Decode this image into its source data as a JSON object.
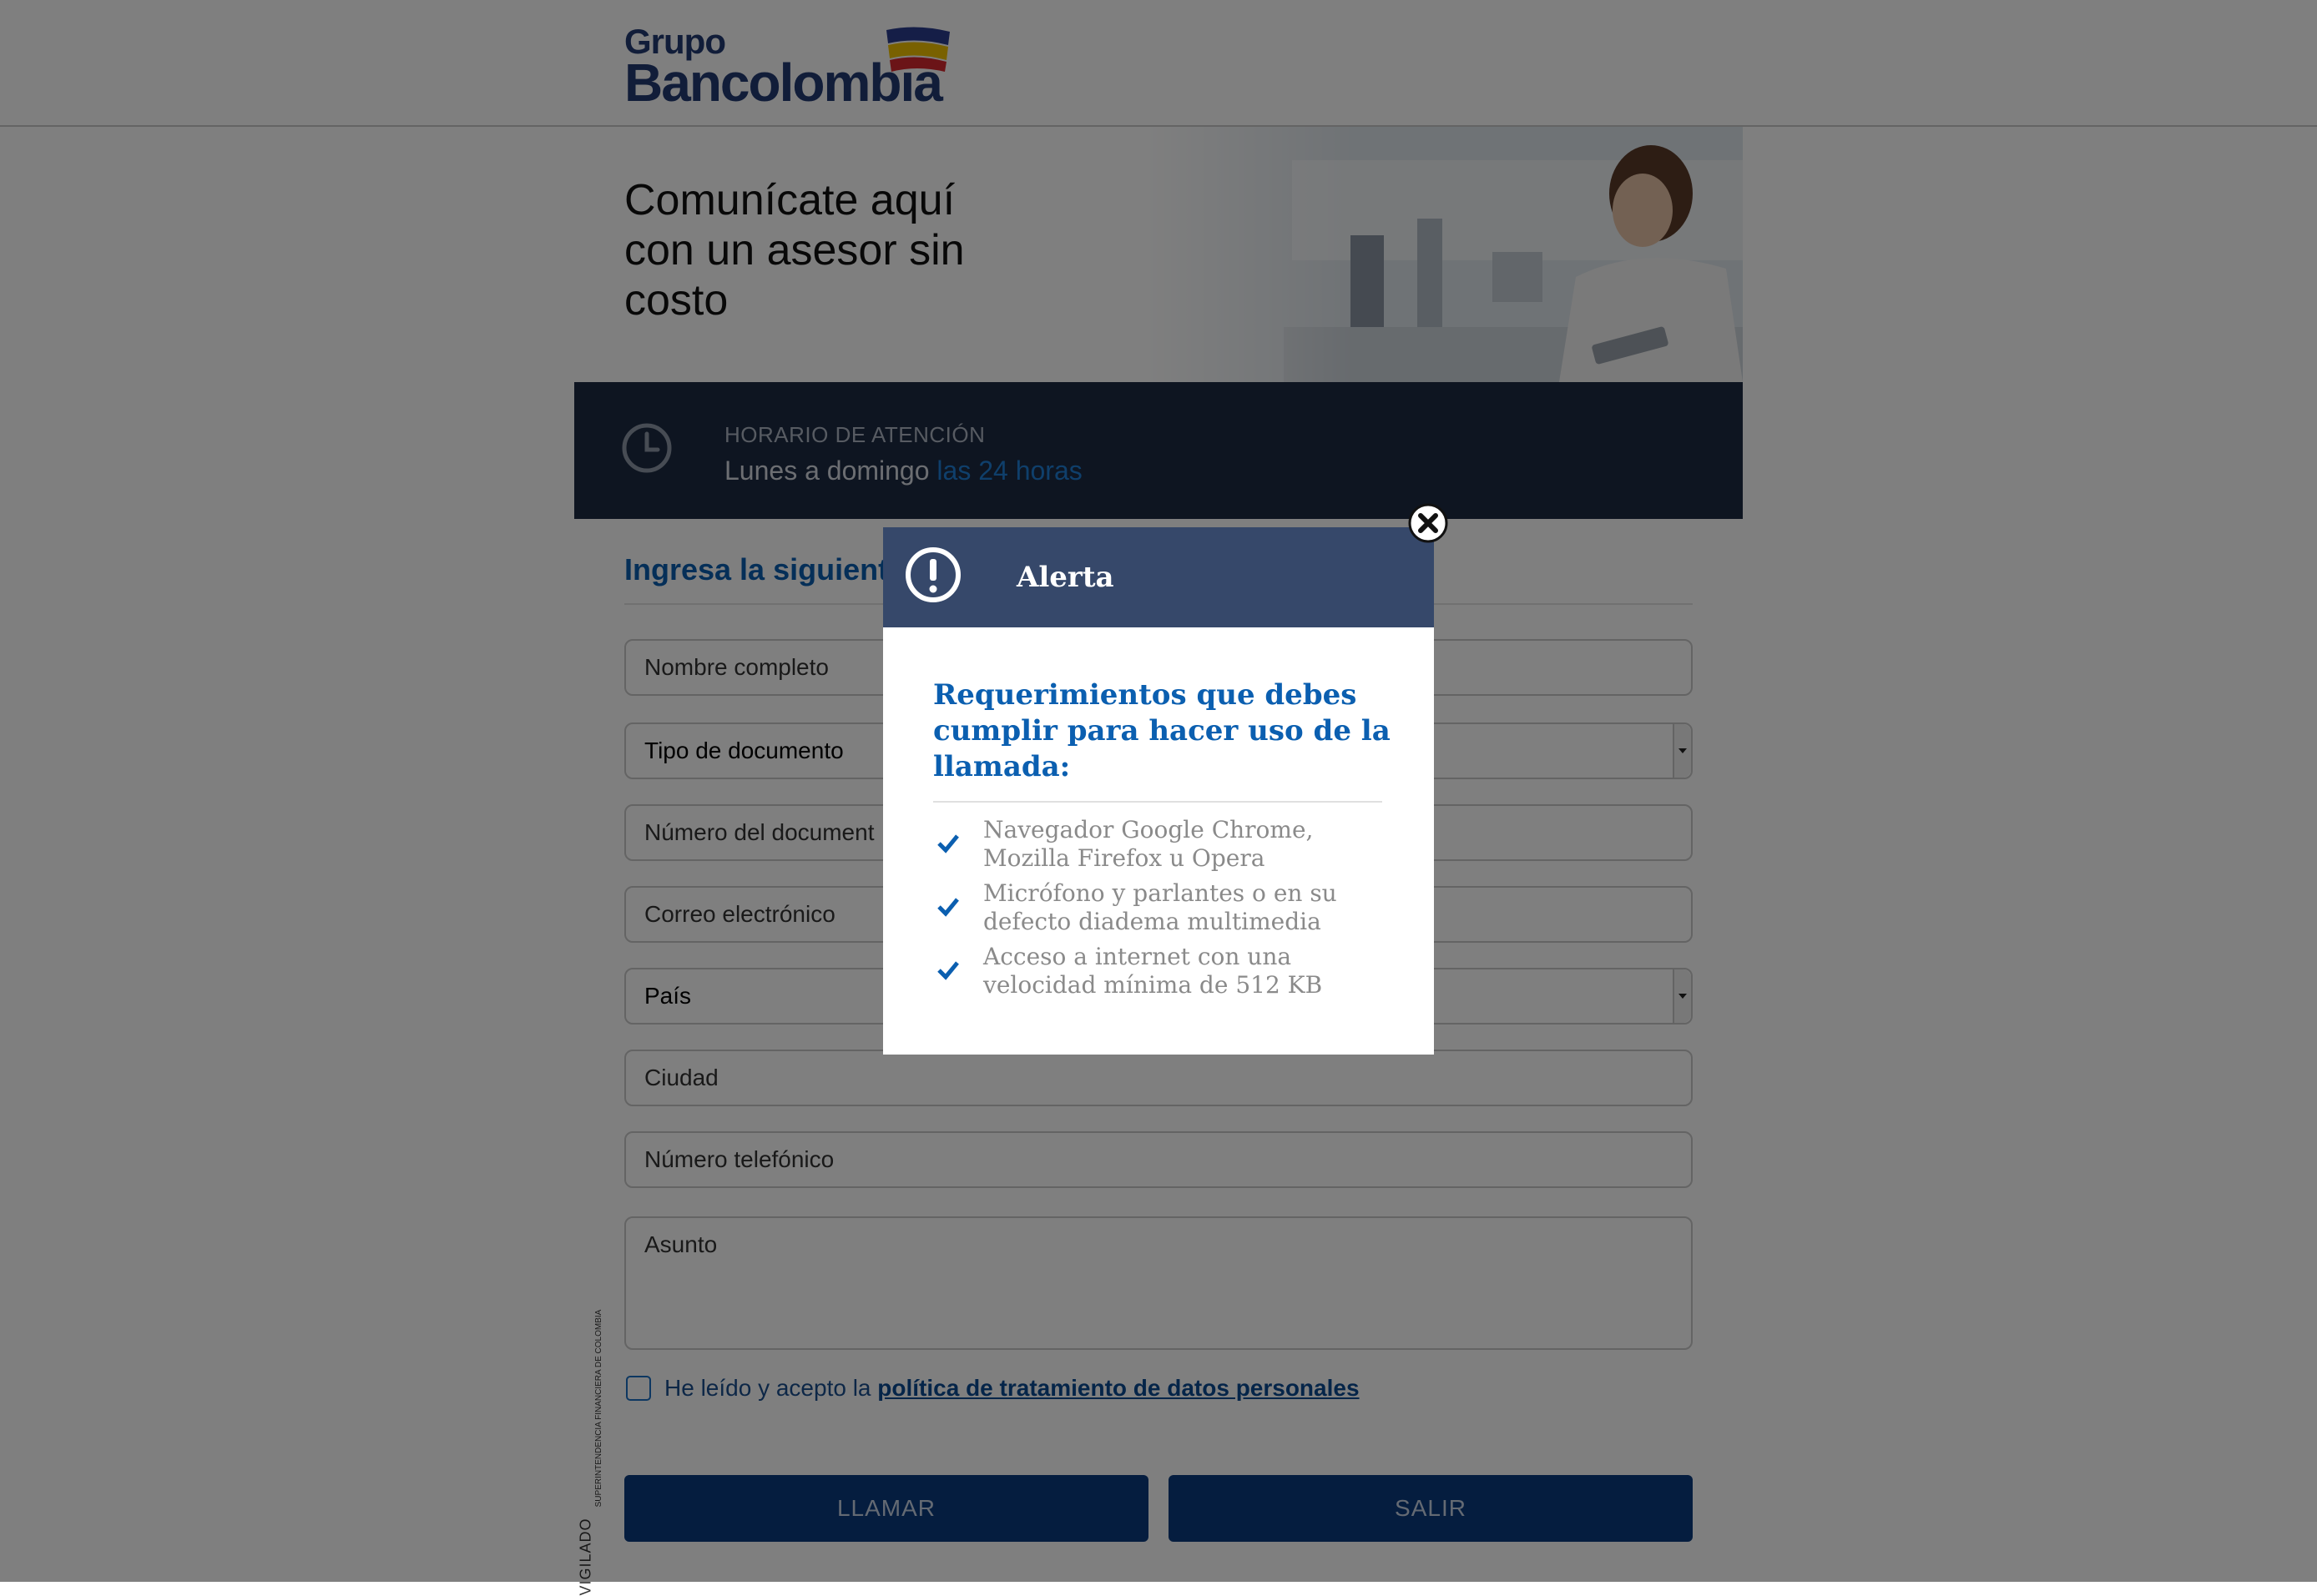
{
  "brand": {
    "line1": "Grupo",
    "line2": "Bancolombia"
  },
  "hero": {
    "title": "Comunícate aquí con un asesor sin costo"
  },
  "schedule": {
    "label": "HORARIO DE ATENCIÓN",
    "days": "Lunes a domingo",
    "hours": "las 24 horas"
  },
  "form": {
    "title": "Ingresa la siguient",
    "fields": {
      "name": "Nombre completo",
      "doc_type": "Tipo de documento",
      "doc_number": "Número del document",
      "email": "Correo electrónico",
      "country": "País",
      "city": "Ciudad",
      "phone": "Número telefónico",
      "subject": "Asunto"
    },
    "consent_prefix": "He leído y acepto la",
    "consent_link": "política de tratamiento de datos personales",
    "call_button": "LLAMAR",
    "exit_button": "SALIR"
  },
  "vigilado": {
    "main": "VIGILADO",
    "sub": "SUPERINTENDENCIA FINANCIERA DE COLOMBIA"
  },
  "modal": {
    "title": "Alerta",
    "heading": "Requerimientos que debes cumplir para hacer uso de la llamada:",
    "items": [
      "Navegador Google Chrome, Mozilla Firefox u Opera",
      "Micrófono y parlantes o en su defecto diadema multimedia",
      "Acceso a internet con una velocidad mínima de 512 KB"
    ]
  },
  "colors": {
    "primary": "#0a3a7f",
    "header_dark": "#1c2a42",
    "modal_head": "#36486a",
    "accent_blue": "#0b5fb0"
  }
}
